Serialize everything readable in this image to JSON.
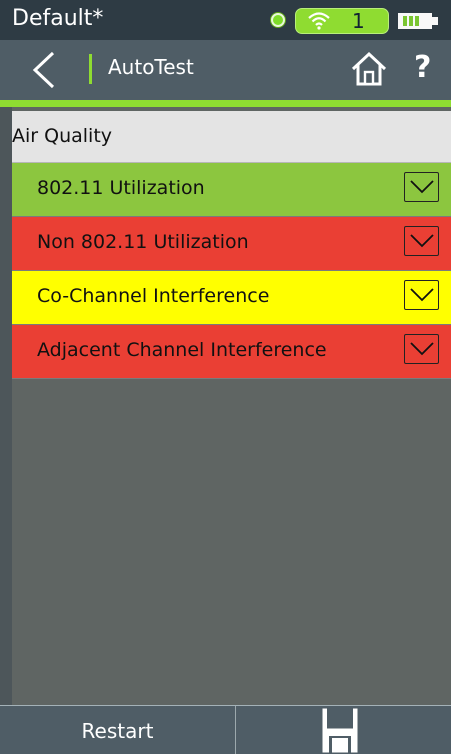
{
  "status": {
    "profile_name": "Default*",
    "wifi_count": "1",
    "icons": [
      "link-indicator",
      "wifi-icon",
      "battery-icon"
    ]
  },
  "nav": {
    "title": "AutoTest",
    "icons": [
      "back-icon",
      "home-icon",
      "help-icon"
    ],
    "help_label": "?"
  },
  "section": {
    "title": "Air Quality"
  },
  "rows": [
    {
      "label": "802.11 Utilization",
      "status_color": "#8cc63f"
    },
    {
      "label": "Non 802.11 Utilization",
      "status_color": "#ea3f34"
    },
    {
      "label": "Co-Channel Interference",
      "status_color": "#ffff00"
    },
    {
      "label": "Adjacent Channel Interference",
      "status_color": "#ea3f34"
    }
  ],
  "footer": {
    "restart_label": "Restart",
    "save_icon": "save-icon"
  },
  "colors": {
    "accent": "#8fdc31",
    "pass": "#8cc63f",
    "fail": "#ea3f34",
    "warning": "#ffff00",
    "panel": "#5f6563"
  }
}
